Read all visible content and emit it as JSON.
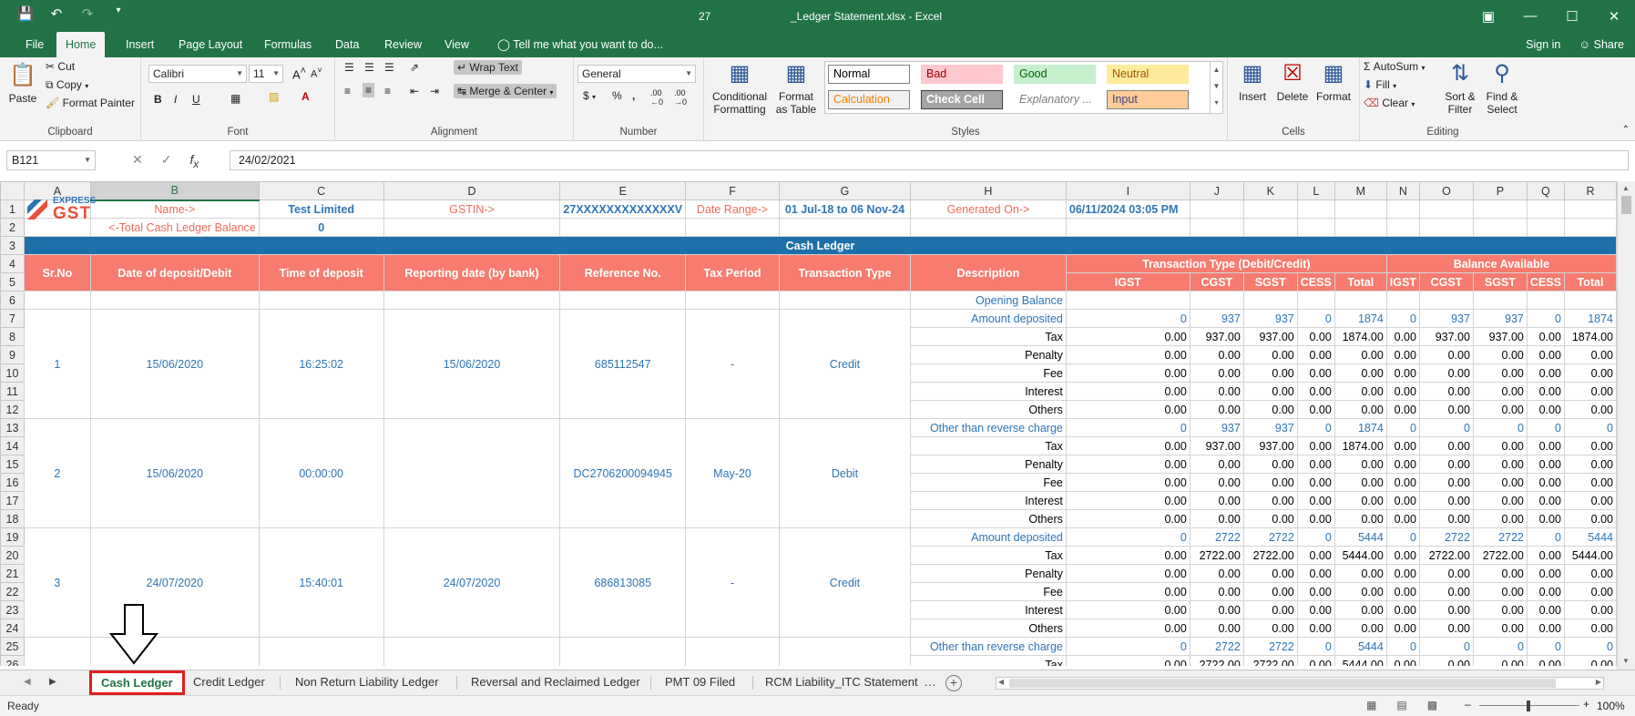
{
  "window": {
    "center_text": "27",
    "title": "_Ledger Statement.xlsx - Excel"
  },
  "ribbon_tabs": [
    "File",
    "Home",
    "Insert",
    "Page Layout",
    "Formulas",
    "Data",
    "Review",
    "View"
  ],
  "tell_me": "Tell me what you want to do...",
  "signin": "Sign in",
  "share": "Share",
  "ribbon": {
    "clipboard": {
      "paste": "Paste",
      "cut": "Cut",
      "copy": "Copy",
      "format_painter": "Format Painter",
      "label": "Clipboard"
    },
    "font": {
      "name": "Calibri",
      "size": "11",
      "label": "Font"
    },
    "alignment": {
      "wrap": "Wrap Text",
      "merge": "Merge & Center",
      "label": "Alignment"
    },
    "number": {
      "format": "General",
      "label": "Number"
    },
    "styles": {
      "conditional": "Conditional Formatting",
      "format_table": "Format as Table",
      "cells": [
        {
          "text": "Normal",
          "bg": "#ffffff",
          "color": "#000000",
          "border": "#7f7f7f"
        },
        {
          "text": "Bad",
          "bg": "#ffc7ce",
          "color": "#9c0006",
          "border": "#ffc7ce"
        },
        {
          "text": "Good",
          "bg": "#c6efce",
          "color": "#006100",
          "border": "#c6efce"
        },
        {
          "text": "Neutral",
          "bg": "#ffeb9c",
          "color": "#9c5700",
          "border": "#ffeb9c"
        },
        {
          "text": "Calculation",
          "bg": "#f2f2f2",
          "color": "#fa7d00",
          "border": "#7f7f7f"
        },
        {
          "text": "Check Cell",
          "bg": "#a5a5a5",
          "color": "#ffffff",
          "border": "#3f3f3f"
        },
        {
          "text": "Explanatory ...",
          "bg": "#ffffff",
          "color": "#7f7f7f",
          "border": "#ffffff"
        },
        {
          "text": "Input",
          "bg": "#ffcc99",
          "color": "#3f3f76",
          "border": "#7f7f7f"
        }
      ],
      "label": "Styles"
    },
    "cells": {
      "insert": "Insert",
      "delete": "Delete",
      "format": "Format",
      "label": "Cells"
    },
    "editing": {
      "autosum": "AutoSum",
      "fill": "Fill",
      "clear": "Clear",
      "sort": "Sort & Filter",
      "find": "Find & Select",
      "label": "Editing"
    }
  },
  "formula_bar": {
    "name_box": "B121",
    "value": "24/02/2021"
  },
  "columns": [
    "A",
    "B",
    "C",
    "D",
    "E",
    "F",
    "G",
    "H",
    "I",
    "J",
    "K",
    "L",
    "M",
    "N",
    "O",
    "P",
    "Q",
    "R"
  ],
  "header": {
    "name_label": "Name->",
    "name_value": "Test Limited",
    "gstin_label": "GSTIN->",
    "gstin_value": "27XXXXXXXXXXXXXV",
    "date_range_label": "Date Range->",
    "date_range_value": "01 Jul-18 to 06 Nov-24",
    "generated_label": "Generated On->",
    "generated_value": "06/11/2024 03:05 PM",
    "total_balance_label": "Total Cash Ledger Balance->",
    "total_balance_value": "0"
  },
  "logo": {
    "top": "EXPRESS",
    "bottom": "GST"
  },
  "banner": "Cash Ledger",
  "table_headers": {
    "sr": "Sr.No",
    "date": "Date  of deposit/Debit",
    "time": "Time of deposit",
    "reporting": "Reporting date (by bank)",
    "ref": "Reference No.",
    "period": "Tax Period",
    "type": "Transaction Type",
    "desc": "Description",
    "txn_group": "Transaction Type (Debit/Credit)",
    "bal_group": "Balance Available",
    "sub": [
      "IGST",
      "CGST",
      "SGST",
      "CESS",
      "Total",
      "IGST",
      "CGST",
      "SGST",
      "CESS",
      "Total"
    ]
  },
  "opening_balance": "Opening Balance",
  "entries": [
    {
      "sr": "1",
      "date": "15/06/2020",
      "time": "16:25:02",
      "reporting": "15/06/2020",
      "ref": "685112547",
      "period": "-",
      "type": "Credit",
      "rows": [
        [
          "Amount deposited",
          "0",
          "937",
          "937",
          "0",
          "1874",
          "0",
          "937",
          "937",
          "0",
          "1874"
        ],
        [
          "Tax",
          "0.00",
          "937.00",
          "937.00",
          "0.00",
          "1874.00",
          "0.00",
          "937.00",
          "937.00",
          "0.00",
          "1874.00"
        ],
        [
          "Penalty",
          "0.00",
          "0.00",
          "0.00",
          "0.00",
          "0.00",
          "0.00",
          "0.00",
          "0.00",
          "0.00",
          "0.00"
        ],
        [
          "Fee",
          "0.00",
          "0.00",
          "0.00",
          "0.00",
          "0.00",
          "0.00",
          "0.00",
          "0.00",
          "0.00",
          "0.00"
        ],
        [
          "Interest",
          "0.00",
          "0.00",
          "0.00",
          "0.00",
          "0.00",
          "0.00",
          "0.00",
          "0.00",
          "0.00",
          "0.00"
        ],
        [
          "Others",
          "0.00",
          "0.00",
          "0.00",
          "0.00",
          "0.00",
          "0.00",
          "0.00",
          "0.00",
          "0.00",
          "0.00"
        ]
      ]
    },
    {
      "sr": "2",
      "date": "15/06/2020",
      "time": "00:00:00",
      "reporting": "",
      "ref": "DC2706200094945",
      "period": "May-20",
      "type": "Debit",
      "rows": [
        [
          "Other than reverse charge",
          "0",
          "937",
          "937",
          "0",
          "1874",
          "0",
          "0",
          "0",
          "0",
          "0"
        ],
        [
          "Tax",
          "0.00",
          "937.00",
          "937.00",
          "0.00",
          "1874.00",
          "0.00",
          "0.00",
          "0.00",
          "0.00",
          "0.00"
        ],
        [
          "Penalty",
          "0.00",
          "0.00",
          "0.00",
          "0.00",
          "0.00",
          "0.00",
          "0.00",
          "0.00",
          "0.00",
          "0.00"
        ],
        [
          "Fee",
          "0.00",
          "0.00",
          "0.00",
          "0.00",
          "0.00",
          "0.00",
          "0.00",
          "0.00",
          "0.00",
          "0.00"
        ],
        [
          "Interest",
          "0.00",
          "0.00",
          "0.00",
          "0.00",
          "0.00",
          "0.00",
          "0.00",
          "0.00",
          "0.00",
          "0.00"
        ],
        [
          "Others",
          "0.00",
          "0.00",
          "0.00",
          "0.00",
          "0.00",
          "0.00",
          "0.00",
          "0.00",
          "0.00",
          "0.00"
        ]
      ]
    },
    {
      "sr": "3",
      "date": "24/07/2020",
      "time": "15:40:01",
      "reporting": "24/07/2020",
      "ref": "686813085",
      "period": "-",
      "type": "Credit",
      "rows": [
        [
          "Amount deposited",
          "0",
          "2722",
          "2722",
          "0",
          "5444",
          "0",
          "2722",
          "2722",
          "0",
          "5444"
        ],
        [
          "Tax",
          "0.00",
          "2722.00",
          "2722.00",
          "0.00",
          "5444.00",
          "0.00",
          "2722.00",
          "2722.00",
          "0.00",
          "5444.00"
        ],
        [
          "Penalty",
          "0.00",
          "0.00",
          "0.00",
          "0.00",
          "0.00",
          "0.00",
          "0.00",
          "0.00",
          "0.00",
          "0.00"
        ],
        [
          "Fee",
          "0.00",
          "0.00",
          "0.00",
          "0.00",
          "0.00",
          "0.00",
          "0.00",
          "0.00",
          "0.00",
          "0.00"
        ],
        [
          "Interest",
          "0.00",
          "0.00",
          "0.00",
          "0.00",
          "0.00",
          "0.00",
          "0.00",
          "0.00",
          "0.00",
          "0.00"
        ],
        [
          "Others",
          "0.00",
          "0.00",
          "0.00",
          "0.00",
          "0.00",
          "0.00",
          "0.00",
          "0.00",
          "0.00",
          "0.00"
        ]
      ]
    },
    {
      "sr": "",
      "date": "",
      "time": "",
      "reporting": "",
      "ref": "",
      "period": "",
      "type": "",
      "rows": [
        [
          "Other than reverse charge",
          "0",
          "2722",
          "2722",
          "0",
          "5444",
          "0",
          "0",
          "0",
          "0",
          "0"
        ],
        [
          "Tax",
          "0.00",
          "2722.00",
          "2722.00",
          "0.00",
          "5444.00",
          "0.00",
          "0.00",
          "0.00",
          "0.00",
          "0.00"
        ]
      ]
    }
  ],
  "sheet_tabs": [
    "Cash Ledger",
    "Credit Ledger",
    "Non Return Liability Ledger",
    "Reversal and Reclaimed Ledger",
    "PMT 09 Filed",
    "RCM Liability_ITC Statement"
  ],
  "active_sheet": "Cash Ledger",
  "status": {
    "ready": "Ready",
    "zoom": "100%"
  },
  "colors": {
    "excel_green": "#217346",
    "header_salmon": "#f77b6e",
    "banner_blue": "#1f6fa8",
    "value_blue": "#2e75b6",
    "label_salmon": "#f26b5b",
    "annotation_red": "#e01d1d"
  }
}
